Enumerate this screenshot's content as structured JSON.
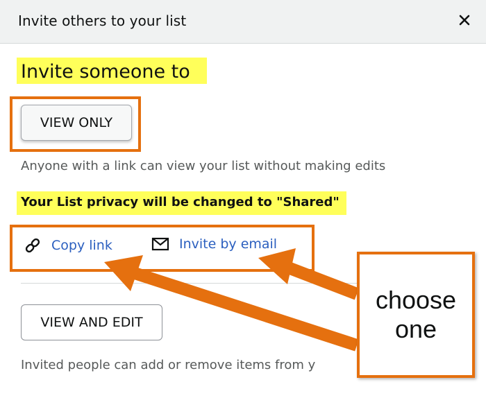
{
  "dialog": {
    "title": "Invite others to your list",
    "close_icon": "close-icon"
  },
  "content": {
    "heading": "Invite someone to",
    "view_only_label": "VIEW ONLY",
    "view_only_desc": "Anyone with a link can view your list without making edits",
    "privacy_note": "Your List privacy will be changed to \"Shared\"",
    "copy_link_label": "Copy link",
    "copy_link_icon": "link-icon",
    "invite_email_label": "Invite by email",
    "invite_email_icon": "envelope-icon",
    "view_edit_label": "VIEW AND EDIT",
    "view_edit_desc": "Invited people can add or remove items from y"
  },
  "annotation": {
    "callout_line1": "choose",
    "callout_line2": "one",
    "accent_color": "#e5700f",
    "highlight_color": "#ffff5a"
  }
}
